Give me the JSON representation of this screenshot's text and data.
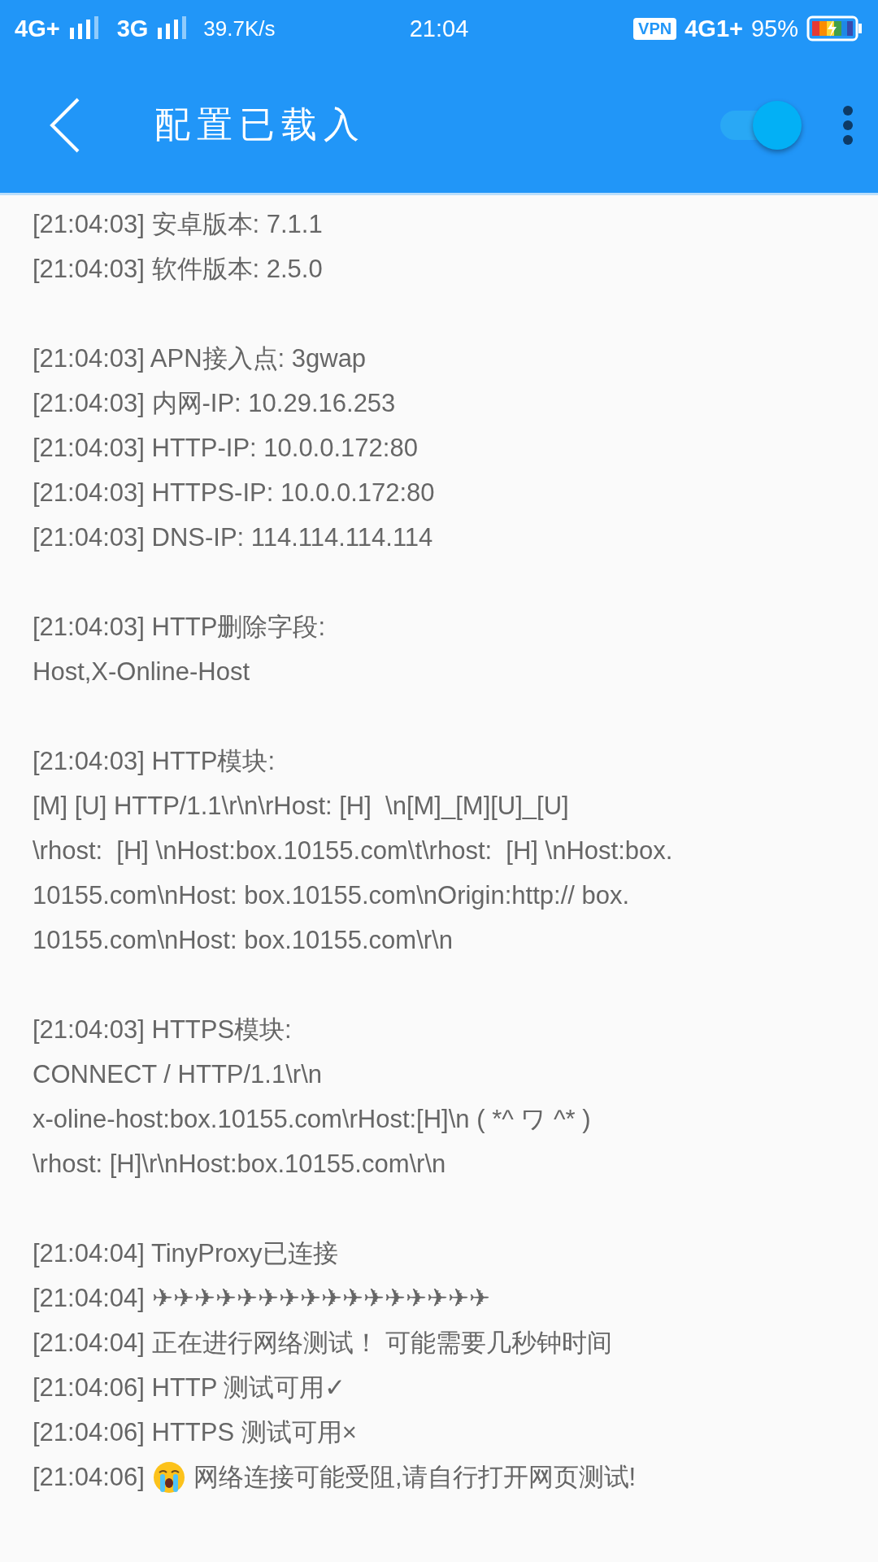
{
  "status_bar": {
    "network_1": "4G+",
    "network_2": "3G",
    "speed": "39.7K/s",
    "time": "21:04",
    "vpn": "VPN",
    "network_3": "4G1+",
    "battery": "95%"
  },
  "app_bar": {
    "title": "配置已载入",
    "switch": {
      "on": true
    }
  },
  "log_groups": [
    [
      {
        "kind": "text",
        "text": "[21:04:03] 安卓版本: 7.1.1"
      },
      {
        "kind": "text",
        "text": "[21:04:03] 软件版本: 2.5.0"
      }
    ],
    [
      {
        "kind": "text",
        "text": "[21:04:03] APN接入点: 3gwap"
      },
      {
        "kind": "text",
        "text": "[21:04:03] 内网-IP: 10.29.16.253"
      },
      {
        "kind": "text",
        "text": "[21:04:03] HTTP-IP: 10.0.0.172:80"
      },
      {
        "kind": "text",
        "text": "[21:04:03] HTTPS-IP: 10.0.0.172:80"
      },
      {
        "kind": "text",
        "text": "[21:04:03] DNS-IP: 114.114.114.114"
      }
    ],
    [
      {
        "kind": "text",
        "text": "[21:04:03] HTTP删除字段:"
      },
      {
        "kind": "text",
        "text": "Host,X-Online-Host"
      }
    ],
    [
      {
        "kind": "text",
        "text": "[21:04:03] HTTP模块:"
      },
      {
        "kind": "text",
        "text": "[M] [U] HTTP/1.1\\r\\n\\rHost: [H]  \\n[M]_[M][U]_[U]"
      },
      {
        "kind": "text",
        "text": "\\rhost:  [H] \\nHost:box.10155.com\\t\\rhost:  [H] \\nHost:box."
      },
      {
        "kind": "text",
        "text": "10155.com\\nHost: box.10155.com\\nOrigin:http:// box."
      },
      {
        "kind": "text",
        "text": "10155.com\\nHost: box.10155.com\\r\\n"
      }
    ],
    [
      {
        "kind": "text",
        "text": "[21:04:03] HTTPS模块:"
      },
      {
        "kind": "text",
        "text": "CONNECT / HTTP/1.1\\r\\n"
      },
      {
        "kind": "text",
        "text": "x-oline-host:box.10155.com\\rHost:[H]\\n ( *^ ワ ^* )"
      },
      {
        "kind": "text",
        "text": "\\rhost: [H]\\r\\nHost:box.10155.com\\r\\n"
      }
    ],
    [
      {
        "kind": "text",
        "text": "[21:04:04] TinyProxy已连接"
      },
      {
        "kind": "text",
        "text": "[21:04:04] ✈✈✈✈✈✈✈✈✈✈✈✈✈✈✈✈"
      },
      {
        "kind": "text",
        "text": "[21:04:04] 正在进行网络测试！ 可能需要几秒钟时间"
      },
      {
        "kind": "text",
        "text": "[21:04:06] HTTP 测试可用✓"
      },
      {
        "kind": "text",
        "text": "[21:04:06] HTTPS 测试可用×"
      },
      {
        "kind": "emoji",
        "before": "[21:04:06]",
        "after": "网络连接可能受阻,请自行打开网页测试!"
      }
    ]
  ]
}
